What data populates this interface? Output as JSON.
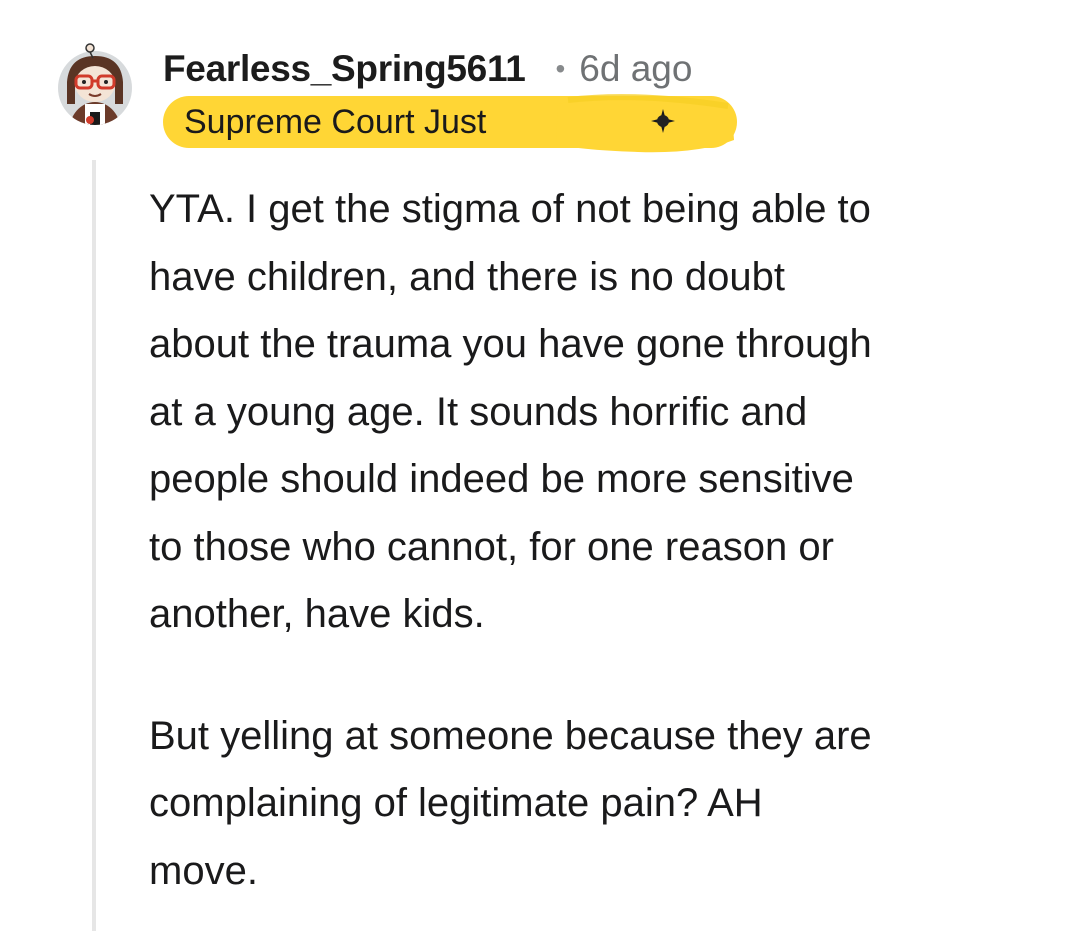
{
  "comment": {
    "username": "Fearless_Spring5611",
    "separator": "•",
    "timestamp": "6d ago",
    "flair": {
      "text": "Supreme Court Just",
      "background": "#ffd635",
      "emoji_icon": "dark-sparkle-emoji"
    },
    "paragraphs": [
      {
        "lines": [
          "YTA. I get the stigma of not being able to",
          "have children, and there is no doubt",
          "about the trauma you have gone through",
          "at a young age. It sounds horrific and",
          "people should indeed be more sensitive",
          "to those who cannot, for one reason or",
          "another, have kids."
        ]
      },
      {
        "lines": [
          "But yelling at someone because they are",
          "complaining of legitimate pain? AH",
          "move."
        ]
      }
    ]
  },
  "colors": {
    "text": "#1a1a1b",
    "meta": "#6f7274",
    "thread_line": "#e6e6e6",
    "flair": "#ffd635"
  }
}
